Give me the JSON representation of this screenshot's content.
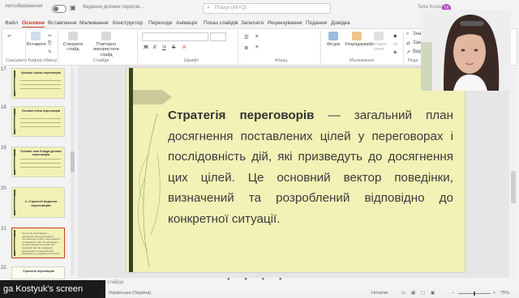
{
  "titlebar": {
    "autosave_label": "Автозбереження",
    "doc_title": "Ведення ділових перегов...",
    "search_placeholder": "Пошук (Alt+Q)",
    "user_name": "Tetia Kostuk",
    "user_initials": "TK"
  },
  "ribbon_tabs": [
    "Файл",
    "Основне",
    "Вставлення",
    "Малювання",
    "Конструктор",
    "Переходи",
    "Анімація",
    "Показ слайдів",
    "Записати",
    "Рецензування",
    "Подання",
    "Довідка"
  ],
  "active_tab": "Основне",
  "ribbon": {
    "paste_label": "Вставити",
    "new_slide_label": "Створити слайд",
    "reuse_label": "Повторно використати слайд",
    "shapes_label": "Фігури",
    "arrange_label": "Упорядкувати",
    "quick_styles_label": "Експрес-стилі",
    "find_label": "Знай",
    "replace_label": "Замі",
    "select_label": "Виді",
    "groups": {
      "undo": "Скасувати",
      "clipboard": "Буфер обміну",
      "slides": "Слайди",
      "font": "Шрифт",
      "paragraph": "Абзац",
      "drawing": "Малювання",
      "editing": "Реда"
    }
  },
  "thumbnails": [
    {
      "num": "17",
      "title": "Критерії оцінки переговорів",
      "body": ""
    },
    {
      "num": "18",
      "title": "Основні етапи переговорів",
      "body": ""
    },
    {
      "num": "19",
      "title": "Основні типи й види ділових переговорів",
      "body": ""
    },
    {
      "num": "20",
      "title": "2. Стратегії ведення переговорів",
      "body": ""
    },
    {
      "num": "21",
      "title": "",
      "body": "Стратегія переговорів — загальний план досягнення поставлених цілей у переговорах і послідовність дій, які призведуть до досягнення цих цілей. Це основний вектор поведінки, визначений та розроблений відповідно до конкретної ситуації."
    },
    {
      "num": "22",
      "title": "Стратегія переговорів",
      "body": ""
    }
  ],
  "selected_thumbnail": "21",
  "slide": {
    "term": "Стратегія переговорів",
    "text": " — загальний план досягнення поставлених цілей у переговорах і послідовність дій, які призведуть до досягнення цих цілей. Це основний вектор поведінки, визначений та розроблений відповідно до конкретної ситуації."
  },
  "notes_placeholder": "Нотатки до слайда",
  "status": {
    "slide_info": "Слайд 21 з 33",
    "language": "Українська (Україна)",
    "notes": "Нотатки",
    "zoom": "75%"
  },
  "screen_share_caption": "ga Kostyuk's screen",
  "colors": {
    "accent": "#c43e1c",
    "slide_bg": "#f2f1b6",
    "slide_bar": "#36432a",
    "leaf": "#9fb66f"
  }
}
